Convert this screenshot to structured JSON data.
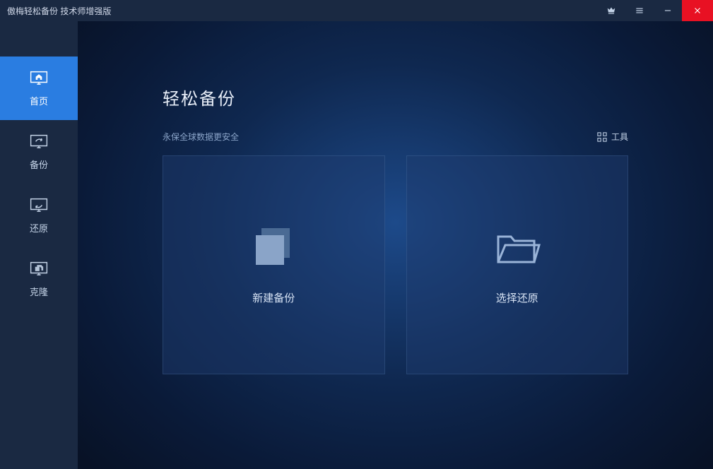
{
  "titlebar": {
    "title": "傲梅轻松备份 技术师增强版"
  },
  "sidebar": {
    "items": [
      {
        "label": "首页"
      },
      {
        "label": "备份"
      },
      {
        "label": "还原"
      },
      {
        "label": "克隆"
      }
    ]
  },
  "main": {
    "title": "轻松备份",
    "subtitle": "永保全球数据更安全",
    "tools_label": "工具",
    "cards": [
      {
        "label": "新建备份"
      },
      {
        "label": "选择还原"
      }
    ]
  }
}
